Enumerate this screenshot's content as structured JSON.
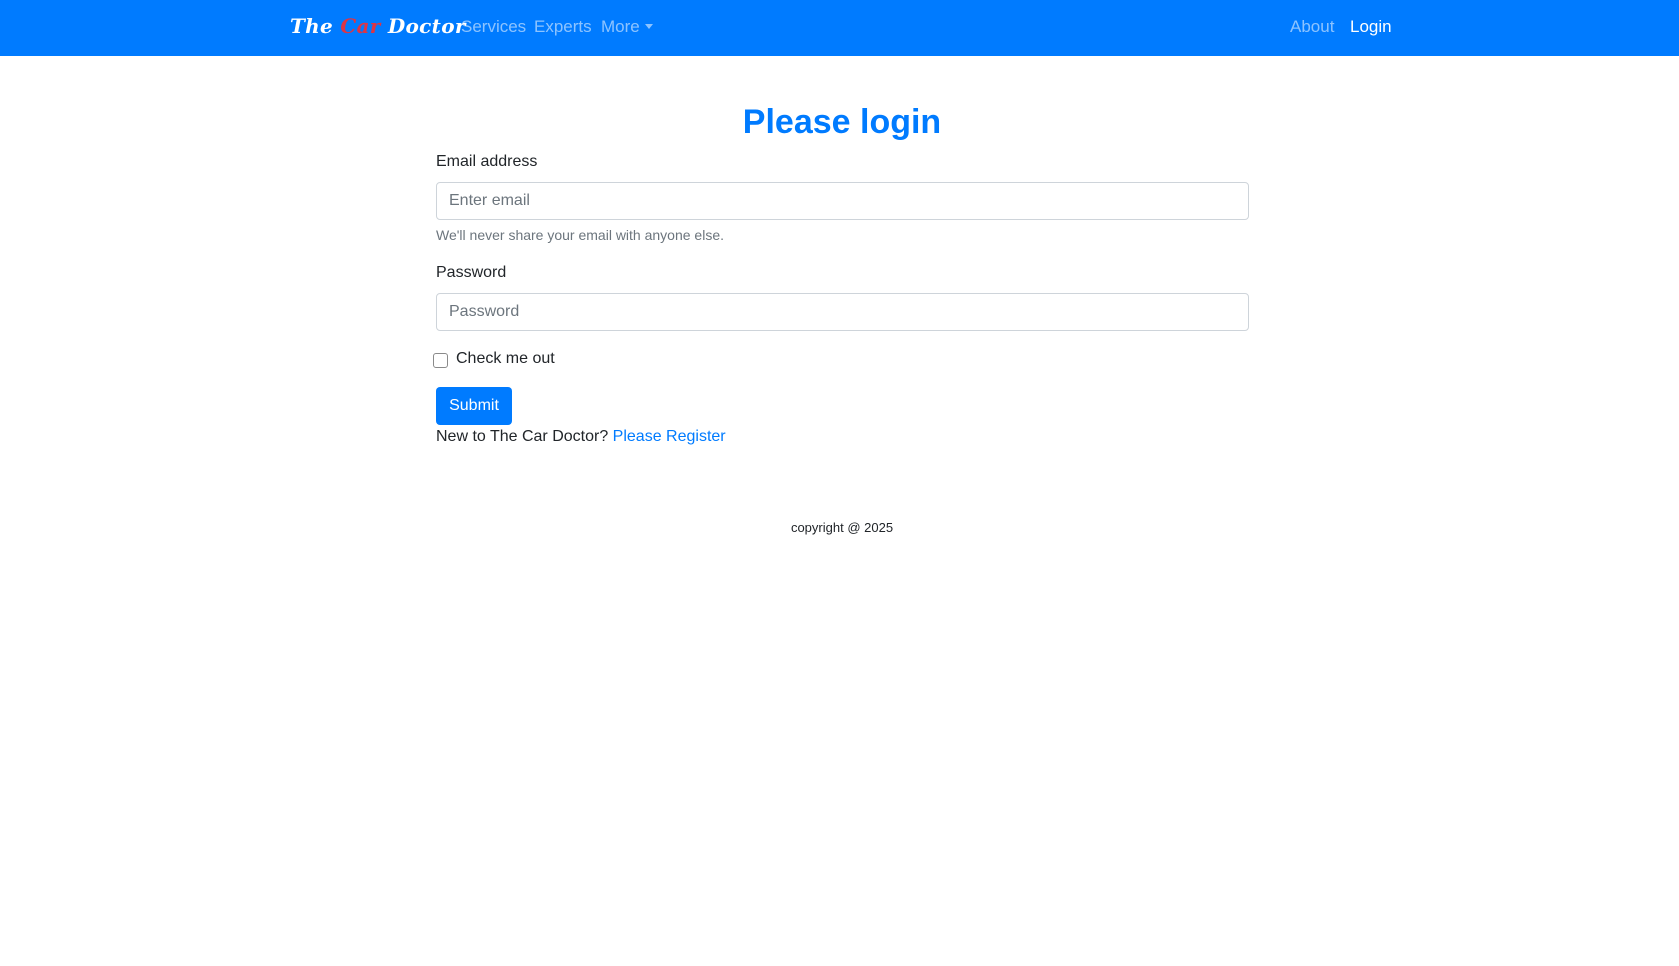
{
  "navbar": {
    "brand": {
      "part1": "The ",
      "part2": "Car",
      "part3": " Doctor"
    },
    "links": {
      "services": "Services",
      "experts": "Experts",
      "more": "More",
      "about": "About",
      "login": "Login"
    },
    "colors": {
      "background": "#007bff",
      "brand_accent": "#dc3545"
    }
  },
  "form": {
    "title": "Please login",
    "email_label": "Email address",
    "email_placeholder": "Enter email",
    "email_help": "We'll never share your email with anyone else.",
    "password_label": "Password",
    "password_placeholder": "Password",
    "checkbox_label": "Check me out",
    "submit_label": "Submit",
    "register_prompt": "New to The Car Doctor?",
    "register_link": "Please Register"
  },
  "footer": {
    "copyright": "copyright @ 2025"
  }
}
